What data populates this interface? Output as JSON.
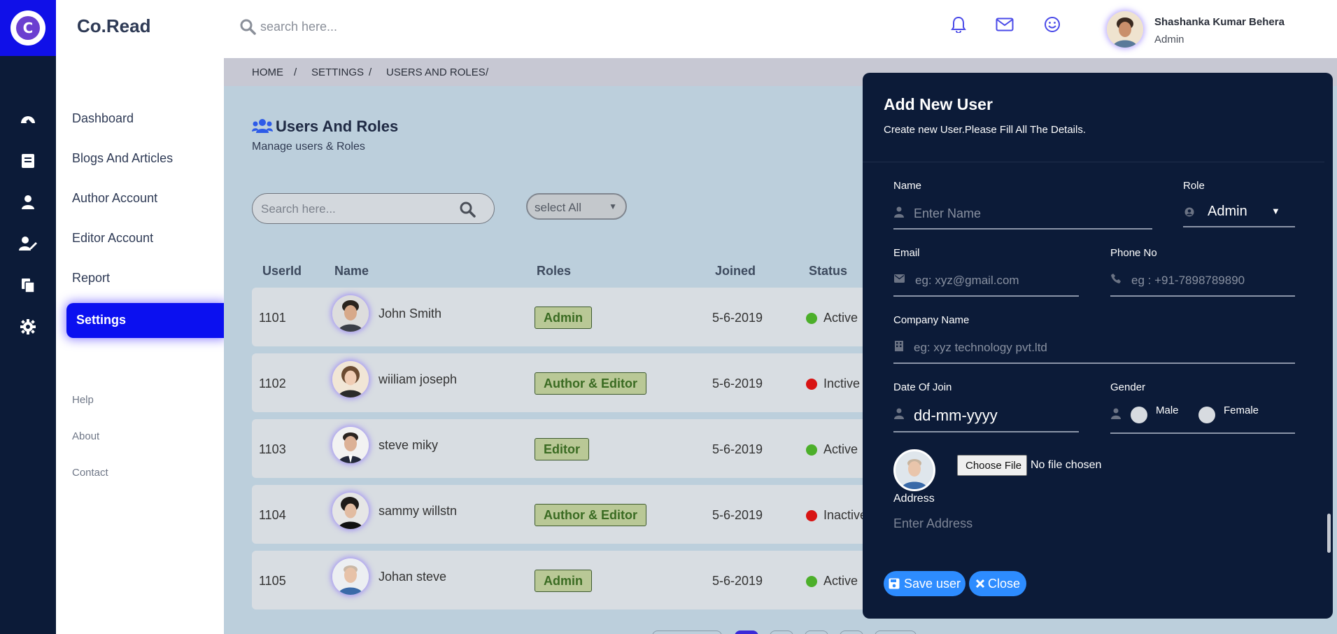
{
  "brand": {
    "name": "Co.Read",
    "logo_letter": "C"
  },
  "rail_icons": [
    "dashboard-gauge-icon",
    "book-icon",
    "user-icon",
    "user-edit-icon",
    "files-icon",
    "gear-icon"
  ],
  "sidebar": {
    "items": [
      {
        "label": "Dashboard"
      },
      {
        "label": "Blogs And Articles"
      },
      {
        "label": "Author Account"
      },
      {
        "label": "Editor Account"
      },
      {
        "label": "Report"
      },
      {
        "label": "Settings",
        "active": true
      }
    ],
    "minor": [
      {
        "label": "Help"
      },
      {
        "label": "About"
      },
      {
        "label": "Contact"
      }
    ]
  },
  "header": {
    "search_placeholder": "search here...",
    "icons": [
      "bell-icon",
      "mail-icon",
      "smile-icon"
    ],
    "user": {
      "name": "Shashanka Kumar Behera",
      "role": "Admin"
    }
  },
  "breadcrumb": [
    "HOME",
    "/",
    "SETTINGS",
    "/",
    "USERS AND ROLES",
    "/"
  ],
  "page": {
    "title": "Users And Roles",
    "subtitle": "Manage users & Roles",
    "search_placeholder": "Search here...",
    "filter_value": "select All"
  },
  "table": {
    "headers": [
      "UserId",
      "Name",
      "Roles",
      "Joined",
      "Status"
    ],
    "rows": [
      {
        "id": "1101",
        "name": "John Smith",
        "role": "Admin",
        "joined": "5-6-2019",
        "status": "Active",
        "status_color": "#4caf2a"
      },
      {
        "id": "1102",
        "name": "wiiliam joseph",
        "role": "Author & Editor",
        "joined": "5-6-2019",
        "status": "Inctive",
        "status_color": "#d81414"
      },
      {
        "id": "1103",
        "name": "steve miky",
        "role": "Editor",
        "joined": "5-6-2019",
        "status": "Active",
        "status_color": "#4caf2a"
      },
      {
        "id": "1104",
        "name": "sammy willstn",
        "role": "Author & Editor",
        "joined": "5-6-2019",
        "status": "Inactive",
        "status_color": "#d81414"
      },
      {
        "id": "1105",
        "name": "Johan steve",
        "role": "Admin",
        "joined": "5-6-2019",
        "status": "Active",
        "status_color": "#4caf2a"
      }
    ]
  },
  "modal": {
    "title": "Add New User",
    "subtitle": "Create new User.Please Fill All The Details.",
    "name_label": "Name",
    "name_placeholder": "Enter Name",
    "role_label": "Role",
    "role_value": "Admin",
    "email_label": "Email",
    "email_placeholder": "eg: xyz@gmail.com",
    "phone_label": "Phone No",
    "phone_placeholder": "eg : +91-7898789890",
    "company_label": "Company Name",
    "company_placeholder": "eg: xyz technology pvt.ltd",
    "doj_label": "Date Of Join",
    "doj_value": "dd-mm-yyyy",
    "gender_label": "Gender",
    "gender_male": "Male",
    "gender_female": "Female",
    "choose_file": "Choose File",
    "no_file": "No file chosen",
    "address_label": "Address",
    "address_placeholder": "Enter Address",
    "save_label": "Save user",
    "close_label": "Close"
  },
  "colors": {
    "rail": "#0c1b38",
    "accent": "#0b10f0",
    "modal_bg": "#0c1b38",
    "button": "#2d8cff",
    "badge_bg": "#b9c896"
  }
}
